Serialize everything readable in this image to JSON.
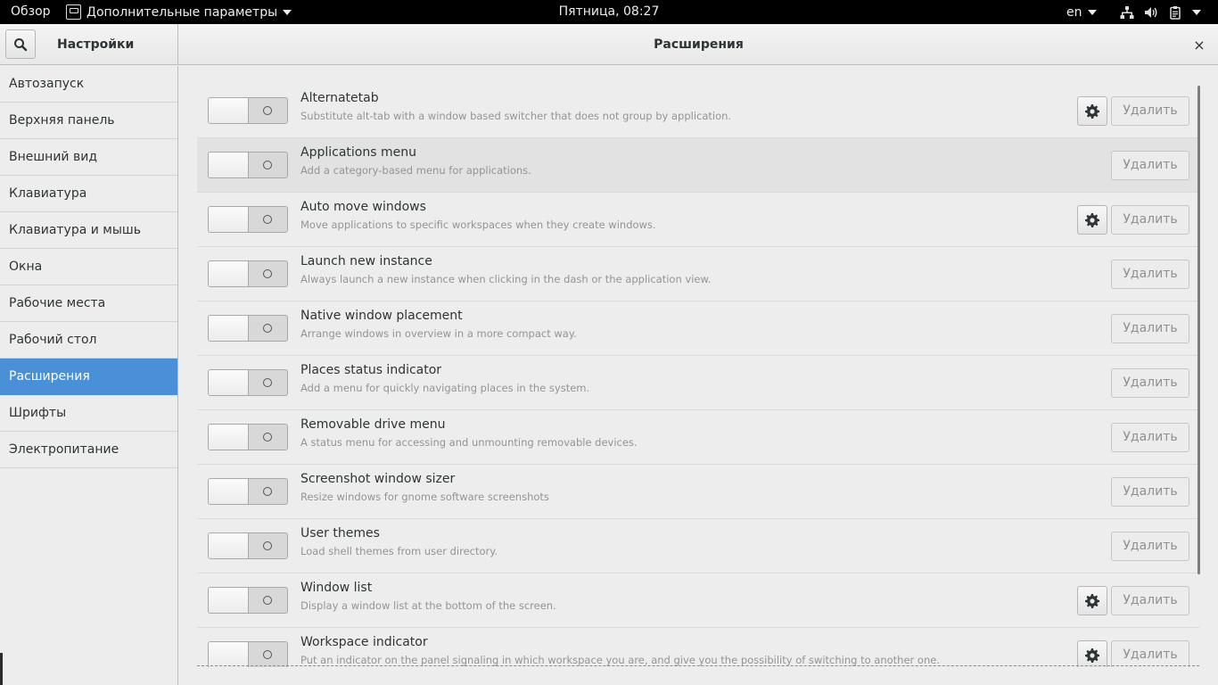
{
  "topbar": {
    "activities": "Обзор",
    "app_menu": "Дополнительные параметры",
    "clock": "Пятница, 08:27",
    "language": "en",
    "icons": [
      "network-icon",
      "volume-icon",
      "battery-clipboard-icon",
      "system-menu-arrow-icon"
    ]
  },
  "header": {
    "settings_title": "Настройки",
    "panel_title": "Расширения",
    "close_glyph": "×"
  },
  "sidebar": {
    "items": [
      {
        "label": "Автозапуск",
        "active": false
      },
      {
        "label": "Верхняя панель",
        "active": false
      },
      {
        "label": "Внешний вид",
        "active": false
      },
      {
        "label": "Клавиатура",
        "active": false
      },
      {
        "label": "Клавиатура и мышь",
        "active": false
      },
      {
        "label": "Окна",
        "active": false
      },
      {
        "label": "Рабочие места",
        "active": false
      },
      {
        "label": "Рабочий стол",
        "active": false
      },
      {
        "label": "Расширения",
        "active": true
      },
      {
        "label": "Шрифты",
        "active": false
      },
      {
        "label": "Электропитание",
        "active": false
      }
    ],
    "active_color": "#4a90d9"
  },
  "extensions": {
    "remove_label": "Удалить",
    "items": [
      {
        "name": "Alternatetab",
        "description": "Substitute alt-tab with a window based switcher that does not group by application.",
        "has_settings": true,
        "enabled": false,
        "hover": false
      },
      {
        "name": "Applications menu",
        "description": "Add a category-based menu for applications.",
        "has_settings": false,
        "enabled": false,
        "hover": true
      },
      {
        "name": "Auto move windows",
        "description": "Move applications to specific workspaces when they create windows.",
        "has_settings": true,
        "enabled": false,
        "hover": false
      },
      {
        "name": "Launch new instance",
        "description": "Always launch a new instance when clicking in the dash or the application view.",
        "has_settings": false,
        "enabled": false,
        "hover": false
      },
      {
        "name": "Native window placement",
        "description": "Arrange windows in overview in a more compact way.",
        "has_settings": false,
        "enabled": false,
        "hover": false
      },
      {
        "name": "Places status indicator",
        "description": "Add a menu for quickly navigating places in the system.",
        "has_settings": false,
        "enabled": false,
        "hover": false
      },
      {
        "name": "Removable drive menu",
        "description": "A status menu for accessing and unmounting removable devices.",
        "has_settings": false,
        "enabled": false,
        "hover": false
      },
      {
        "name": "Screenshot window sizer",
        "description": "Resize windows for gnome software screenshots",
        "has_settings": false,
        "enabled": false,
        "hover": false
      },
      {
        "name": "User themes",
        "description": "Load shell themes from user directory.",
        "has_settings": false,
        "enabled": false,
        "hover": false
      },
      {
        "name": "Window list",
        "description": "Display a window list at the bottom of the screen.",
        "has_settings": true,
        "enabled": false,
        "hover": false
      },
      {
        "name": "Workspace indicator",
        "description": "Put an indicator on the panel signaling in which workspace you are, and give you the possibility of switching to another one.",
        "has_settings": true,
        "enabled": false,
        "hover": false
      }
    ]
  }
}
